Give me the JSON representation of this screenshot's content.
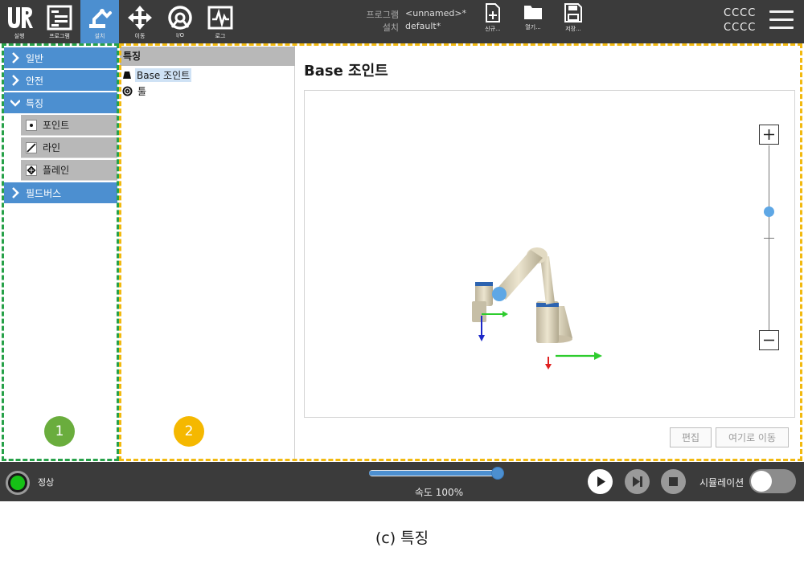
{
  "topbar": {
    "nav": [
      {
        "label": "실행",
        "icon": "ur-logo-icon"
      },
      {
        "label": "프로그램",
        "icon": "program-icon"
      },
      {
        "label": "설치",
        "icon": "installation-icon",
        "active": true
      },
      {
        "label": "이동",
        "icon": "move-arrows-icon"
      },
      {
        "label": "I/O",
        "icon": "io-icon"
      },
      {
        "label": "로그",
        "icon": "log-icon"
      }
    ],
    "program_key": "프로그램",
    "program_value": "<unnamed>*",
    "install_key": "설치",
    "install_value": "default*",
    "file_buttons": [
      {
        "label": "신규...",
        "icon": "new-file-icon"
      },
      {
        "label": "열기...",
        "icon": "open-folder-icon"
      },
      {
        "label": "저장...",
        "icon": "save-disk-icon"
      }
    ],
    "robot_line1": "CCCC",
    "robot_line2": "CCCC"
  },
  "sidebar": {
    "items": [
      {
        "label": "일반",
        "expanded": false
      },
      {
        "label": "안전",
        "expanded": false
      },
      {
        "label": "특징",
        "expanded": true
      },
      {
        "label": "필드버스",
        "expanded": false
      }
    ],
    "sub_items": [
      {
        "label": "포인트",
        "icon": "point-icon"
      },
      {
        "label": "라인",
        "icon": "line-icon"
      },
      {
        "label": "플레인",
        "icon": "plane-icon"
      }
    ]
  },
  "tree": {
    "header": "특징",
    "rows": [
      {
        "label": "Base 조인트",
        "icon": "base-joint-icon",
        "selected": true
      },
      {
        "label": "툴",
        "icon": "tool-icon",
        "selected": false
      }
    ]
  },
  "main": {
    "title": "Base 조인트",
    "zoom_level": 0.65,
    "edit_label": "편집",
    "move_here_label": "여기로 이동"
  },
  "annotations": {
    "badge1": "1",
    "badge2": "2",
    "green": "#27a149",
    "yellow": "#f2b90f",
    "badge1_color": "#6aad3d",
    "badge2_color": "#f5b800"
  },
  "bottombar": {
    "status": "정상",
    "speed_label": "속도 100%",
    "speed_fraction": 1.0,
    "simulation_label": "시뮬레이션",
    "simulation_on": false
  },
  "caption": "(c) 특징",
  "colors": {
    "accent": "#4c8fd0",
    "topbar": "#3b3b3b",
    "status_ok": "#16c116"
  }
}
